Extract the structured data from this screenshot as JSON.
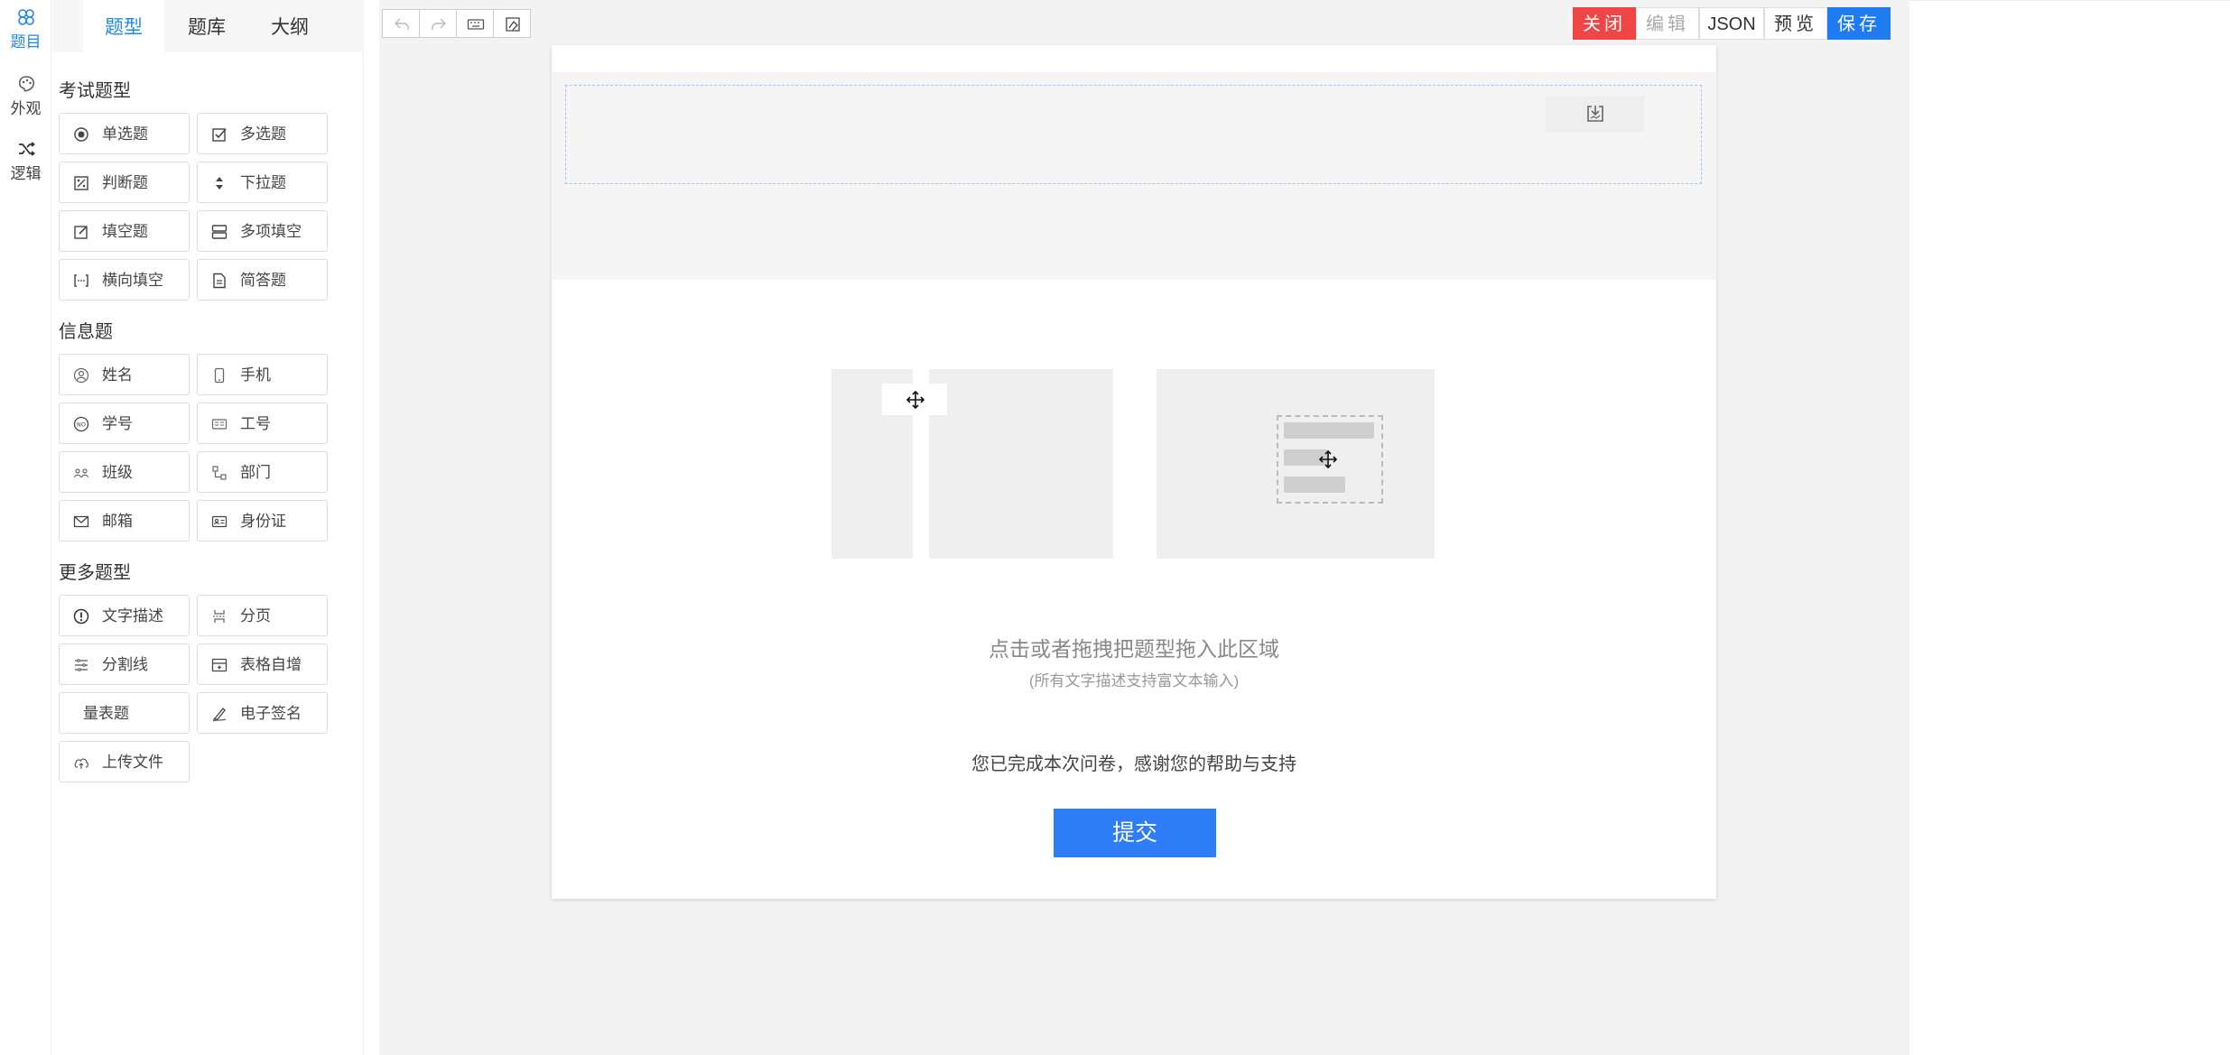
{
  "rail": {
    "items": [
      {
        "label": "题目",
        "icon": "cluster-icon"
      },
      {
        "label": "外观",
        "icon": "palette-icon"
      },
      {
        "label": "逻辑",
        "icon": "shuffle-icon"
      }
    ]
  },
  "tabs": [
    {
      "label": "题型"
    },
    {
      "label": "题库"
    },
    {
      "label": "大纲"
    }
  ],
  "sections": {
    "exam": {
      "title": "考试题型",
      "items": [
        {
          "label": "单选题",
          "icon": "radio-icon"
        },
        {
          "label": "多选题",
          "icon": "checkbox-icon"
        },
        {
          "label": "判断题",
          "icon": "judge-icon"
        },
        {
          "label": "下拉题",
          "icon": "dropdown-icon"
        },
        {
          "label": "填空题",
          "icon": "edit-icon"
        },
        {
          "label": "多项填空",
          "icon": "multi-fill-icon"
        },
        {
          "label": "横向填空",
          "icon": "inline-fill-icon"
        },
        {
          "label": "简答题",
          "icon": "document-icon"
        }
      ]
    },
    "info": {
      "title": "信息题",
      "items": [
        {
          "label": "姓名",
          "icon": "user-icon"
        },
        {
          "label": "手机",
          "icon": "phone-icon"
        },
        {
          "label": "学号",
          "icon": "no-icon"
        },
        {
          "label": "工号",
          "icon": "id-card-icon"
        },
        {
          "label": "班级",
          "icon": "group-icon"
        },
        {
          "label": "部门",
          "icon": "org-icon"
        },
        {
          "label": "邮箱",
          "icon": "mail-icon"
        },
        {
          "label": "身份证",
          "icon": "idcard-icon"
        }
      ]
    },
    "more": {
      "title": "更多题型",
      "items": [
        {
          "label": "文字描述",
          "icon": "info-icon"
        },
        {
          "label": "分页",
          "icon": "page-break-icon"
        },
        {
          "label": "分割线",
          "icon": "divider-icon"
        },
        {
          "label": "表格自增",
          "icon": "table-add-icon"
        },
        {
          "label": "量表题",
          "icon": ""
        },
        {
          "label": "电子签名",
          "icon": "signature-icon"
        },
        {
          "label": "上传文件",
          "icon": "upload-icon"
        }
      ]
    }
  },
  "toolbar": {
    "close": "关闭",
    "edit": "编辑",
    "json": "JSON",
    "preview": "预览",
    "save": "保存"
  },
  "canvas": {
    "hint_main": "点击或者拖拽把题型拖入此区域",
    "hint_sub": "(所有文字描述支持富文本输入)",
    "thanks": "您已完成本次问卷，感谢您的帮助与支持",
    "submit": "提交"
  },
  "colors": {
    "accent": "#1e88e5",
    "close": "#f04545",
    "save": "#1e7cf0",
    "submit": "#2e7cf6"
  }
}
